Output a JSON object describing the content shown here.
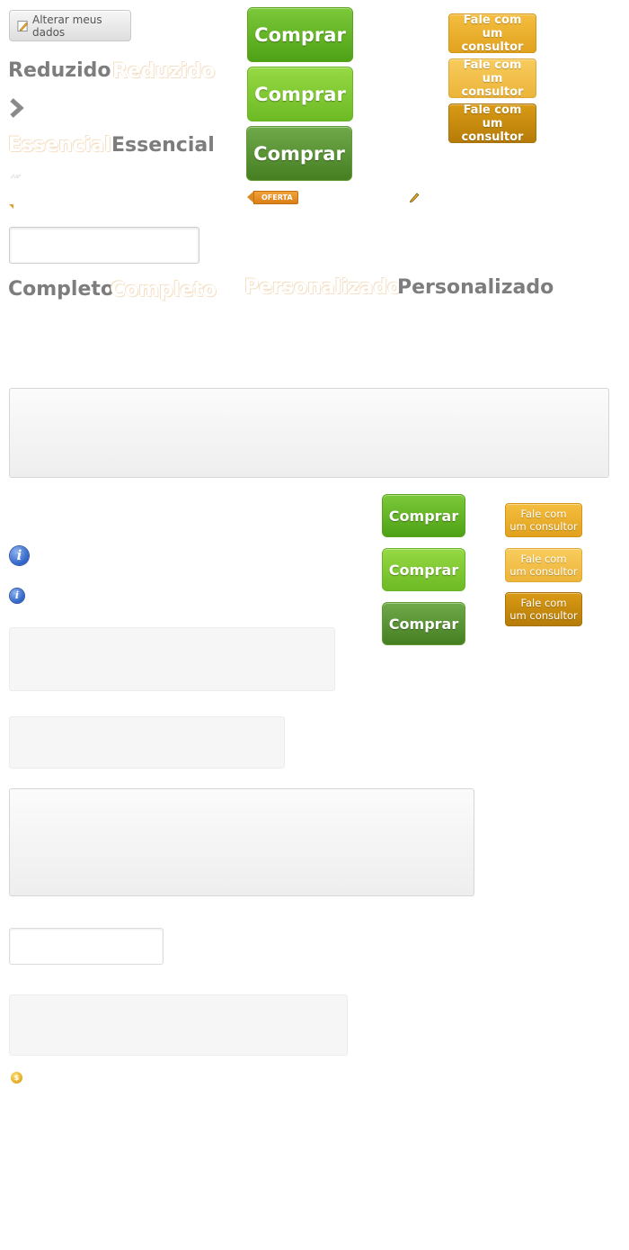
{
  "edit_button": {
    "label": "Alterar meus dados",
    "icon": "pencil-note-icon"
  },
  "plans": {
    "reduzido": "Reduzido",
    "essencial": "Essencial",
    "completo": "Completo",
    "personalizado": "Personalizado"
  },
  "buy_label": "Comprar",
  "consult_line1": "Fale com",
  "consult_line2": "um consultor",
  "oferta_label": "OFERTA",
  "icons": {
    "chevron": "chevron-right-icon",
    "pencil": "pencil-icon",
    "info": "info-icon",
    "coin": "coin-icon",
    "info_glyph": "i",
    "coin_glyph": "$"
  },
  "colors": {
    "green": "#6cba24",
    "orange": "#e1a21f",
    "gray_text": "#7d7d7d"
  }
}
